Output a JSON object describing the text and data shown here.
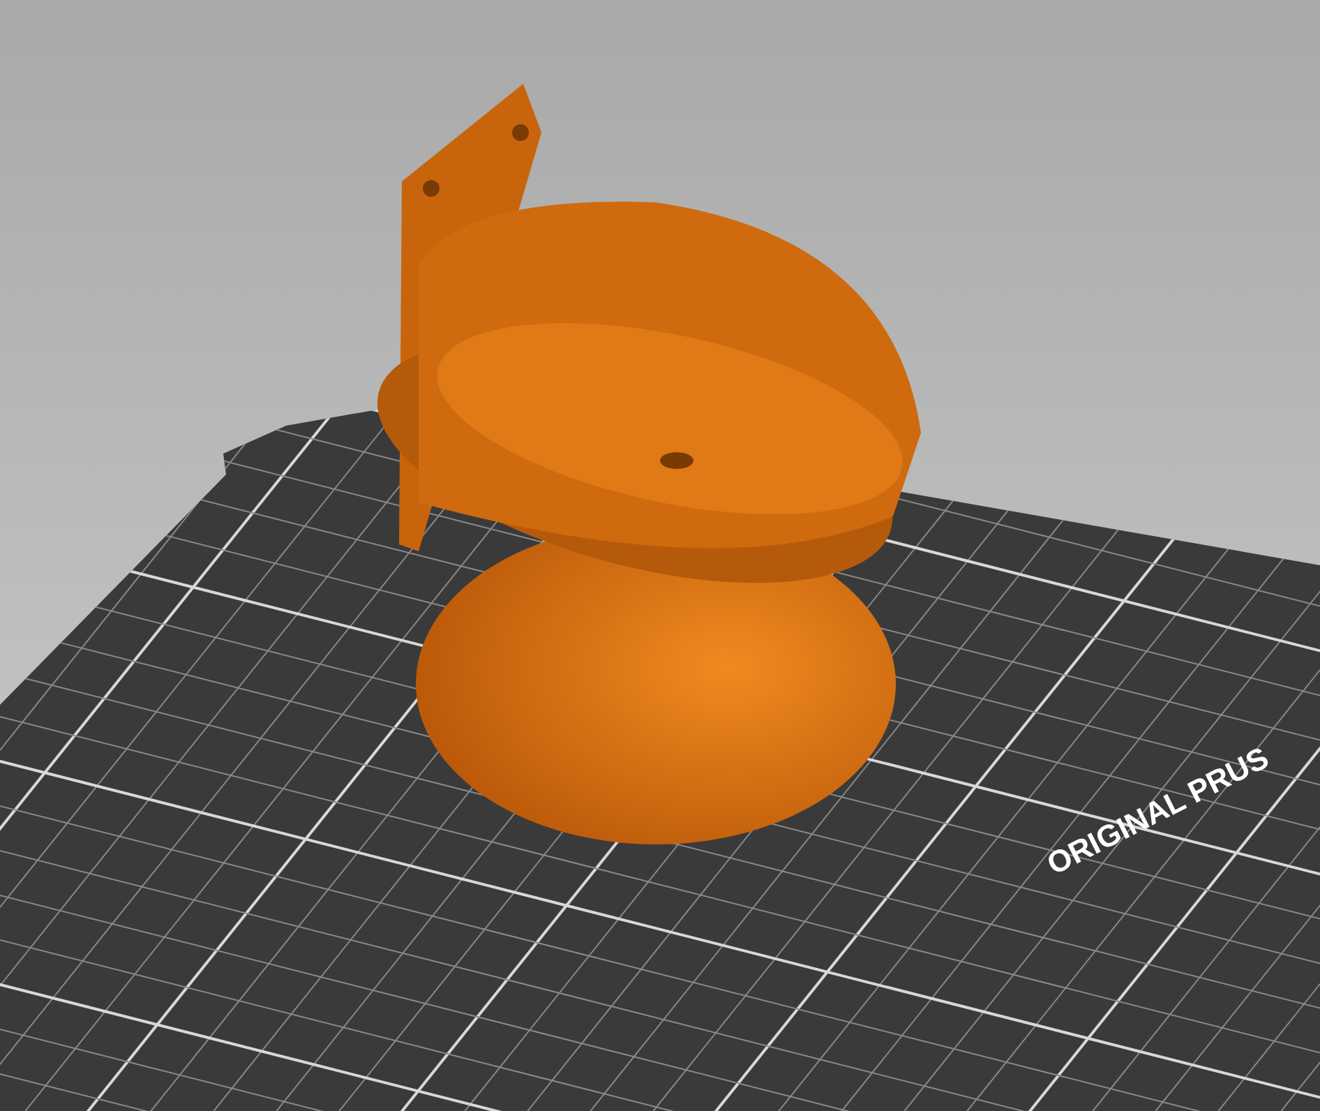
{
  "viewport": {
    "bed_label": "ORIGINAL PRUS"
  }
}
